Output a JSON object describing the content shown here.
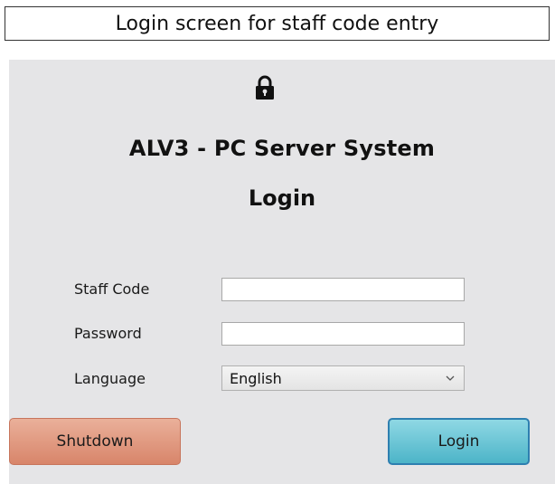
{
  "caption": "Login screen for staff code entry",
  "icons": {
    "lock": "lock-icon",
    "dropdown": "chevron-down-icon"
  },
  "header": {
    "app_title": "ALV3 - PC Server System",
    "screen_title": "Login"
  },
  "form": {
    "staff_code": {
      "label": "Staff Code",
      "value": ""
    },
    "password": {
      "label": "Password",
      "value": ""
    },
    "language": {
      "label": "Language",
      "selected": "English"
    }
  },
  "buttons": {
    "shutdown": "Shutdown",
    "login": "Login"
  },
  "colors": {
    "panel_background": "#e5e5e7",
    "shutdown_button": "#d8856a",
    "login_button": "#4cb4c8",
    "login_button_border": "#2e7fb0"
  }
}
